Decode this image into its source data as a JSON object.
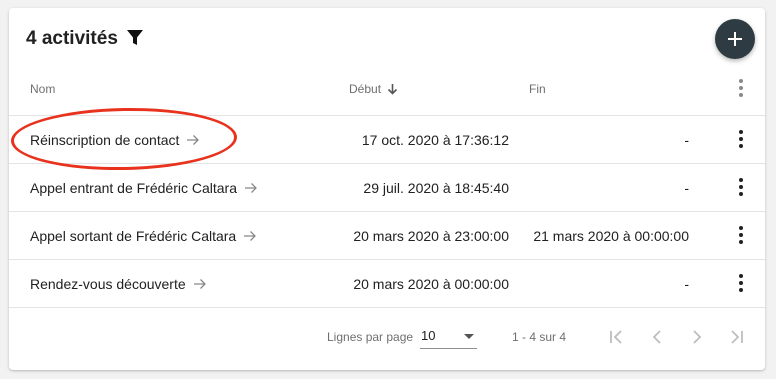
{
  "header": {
    "title": "4 activités",
    "filter_icon": "filter-icon",
    "add_icon": "plus-icon"
  },
  "columns": {
    "name": "Nom",
    "start": "Début",
    "end": "Fin",
    "sort_icon": "arrow-down-icon"
  },
  "rows": [
    {
      "name": "Réinscription de contact",
      "start": "17 oct. 2020 à 17:36:12",
      "end": "-"
    },
    {
      "name": "Appel entrant de Frédéric Caltara",
      "start": "29 juil. 2020 à 18:45:40",
      "end": "-"
    },
    {
      "name": "Appel sortant de Frédéric Caltara",
      "start": "20 mars 2020 à 23:00:00",
      "end": "21 mars 2020 à 00:00:00"
    },
    {
      "name": "Rendez-vous découverte",
      "start": "20 mars 2020 à 00:00:00",
      "end": "-"
    }
  ],
  "footer": {
    "rows_per_page_label": "Lignes par page",
    "rows_per_page_value": "10",
    "range": "1 - 4 sur 4"
  },
  "colors": {
    "fab": "#2f3b42",
    "highlight": "#e8321e"
  }
}
